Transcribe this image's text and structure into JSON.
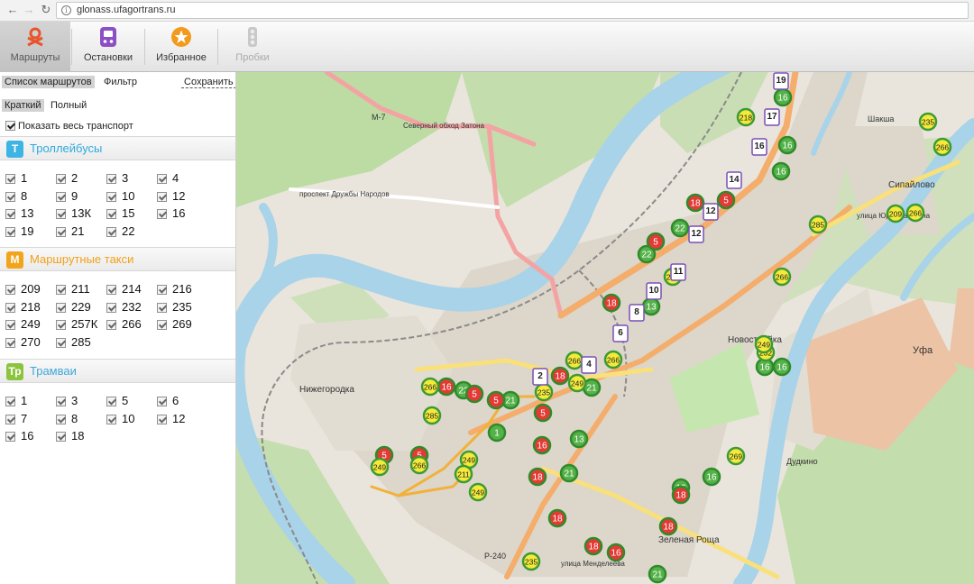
{
  "browser": {
    "url": "glonass.ufagortrans.ru"
  },
  "toolbar": {
    "routes": "Маршруты",
    "stops": "Остановки",
    "favorites": "Избранное",
    "traffic": "Пробки"
  },
  "panel": {
    "tabs": {
      "list": "Список маршрутов",
      "filter": "Фильтр",
      "save": "Сохранить"
    },
    "view": {
      "short": "Краткий",
      "full": "Полный"
    },
    "show_all": "Показать весь транспорт",
    "sections": [
      {
        "badge": "T",
        "title": "Троллейбусы",
        "color": "#3db4e3",
        "routes": [
          "1",
          "2",
          "3",
          "4",
          "8",
          "9",
          "10",
          "12",
          "13",
          "13К",
          "15",
          "16",
          "19",
          "21",
          "22"
        ]
      },
      {
        "badge": "M",
        "title": "Маршрутные такси",
        "color": "#f2a51c",
        "routes": [
          "209",
          "211",
          "214",
          "216",
          "218",
          "229",
          "232",
          "235",
          "249",
          "257К",
          "266",
          "269",
          "270",
          "285"
        ]
      },
      {
        "badge": "Тр",
        "title": "Трамваи",
        "color": "#8cc43f",
        "routes": [
          "1",
          "3",
          "5",
          "6",
          "7",
          "8",
          "10",
          "12",
          "16",
          "18"
        ]
      }
    ]
  },
  "map": {
    "places": [
      "Нижегородка",
      "Новостройка",
      "Зеленая Роща",
      "Сипайлово",
      "Шакша",
      "Уфа",
      "Дудкино"
    ],
    "roads": [
      "М-7",
      "Р-240",
      "Северный обход Затона",
      "проспект Дружбы Народов",
      "улица Менделеева",
      "улица Юрия Гагарина"
    ],
    "stroke_roads": "#f4ad6b",
    "water_color": "#a9d3e8",
    "forest_color": "#b9dba0",
    "vehicles": {
      "trolleybus": [
        {
          "route": "19"
        },
        {
          "route": "17"
        },
        {
          "route": "16"
        },
        {
          "route": "14"
        },
        {
          "route": "12"
        },
        {
          "route": "12"
        },
        {
          "route": "11"
        },
        {
          "route": "10"
        },
        {
          "route": "8"
        },
        {
          "route": "6"
        },
        {
          "route": "4"
        },
        {
          "route": "2"
        }
      ],
      "tram_green": [
        {
          "route": "16"
        },
        {
          "route": "16"
        },
        {
          "route": "16"
        },
        {
          "route": "22"
        },
        {
          "route": "22"
        },
        {
          "route": "13"
        },
        {
          "route": "21"
        },
        {
          "route": "22"
        },
        {
          "route": "21"
        },
        {
          "route": "1"
        },
        {
          "route": "13"
        },
        {
          "route": "21"
        },
        {
          "route": "16"
        },
        {
          "route": "16"
        },
        {
          "route": "16"
        },
        {
          "route": "21"
        },
        {
          "route": "16"
        }
      ],
      "tram_red": [
        {
          "route": "18"
        },
        {
          "route": "5"
        },
        {
          "route": "5"
        },
        {
          "route": "18"
        },
        {
          "route": "16"
        },
        {
          "route": "18"
        },
        {
          "route": "5"
        },
        {
          "route": "5"
        },
        {
          "route": "5"
        },
        {
          "route": "16"
        },
        {
          "route": "18"
        },
        {
          "route": "5"
        },
        {
          "route": "5"
        },
        {
          "route": "18"
        },
        {
          "route": "18"
        },
        {
          "route": "18"
        },
        {
          "route": "16"
        },
        {
          "route": "18"
        }
      ],
      "minibus_yellow": [
        {
          "route": "218"
        },
        {
          "route": "235"
        },
        {
          "route": "266"
        },
        {
          "route": "266"
        },
        {
          "route": "209"
        },
        {
          "route": "285"
        },
        {
          "route": "266"
        },
        {
          "route": "266"
        },
        {
          "route": "266"
        },
        {
          "route": "266"
        },
        {
          "route": "232"
        },
        {
          "route": "249"
        },
        {
          "route": "235"
        },
        {
          "route": "266"
        },
        {
          "route": "285"
        },
        {
          "route": "249"
        },
        {
          "route": "266"
        },
        {
          "route": "249"
        },
        {
          "route": "211"
        },
        {
          "route": "249"
        },
        {
          "route": "269"
        },
        {
          "route": "235"
        },
        {
          "route": "249"
        }
      ]
    }
  }
}
